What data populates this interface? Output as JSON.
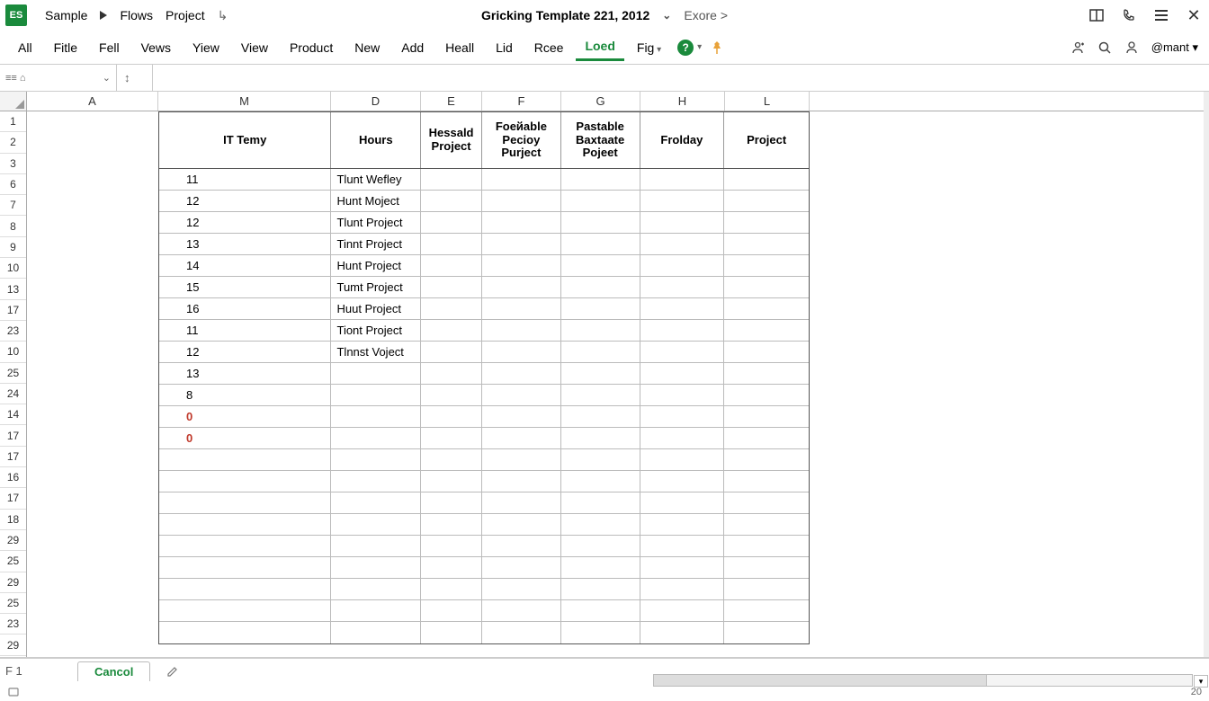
{
  "titlebar": {
    "app_badge": "ES",
    "breadcrumbs": [
      "Sample",
      "Flows",
      "Project"
    ],
    "doc_title": "Gricking Template 221, 2012",
    "more_label": "Exore >",
    "account_label": "@mant"
  },
  "ribbon": {
    "tabs": [
      "All",
      "Fitle",
      "Fell",
      "Vews",
      "Yiew",
      "View",
      "Product",
      "New",
      "Add",
      "Heall",
      "Lid",
      "Rcee",
      "Loed",
      "Fig"
    ],
    "active_index": 12,
    "user_label": "mant"
  },
  "formula": {
    "namebox_icons": "≡≡   ⌂"
  },
  "columns": [
    "A",
    "M",
    "D",
    "E",
    "F",
    "G",
    "H",
    "L"
  ],
  "col_widths": {
    "A": 146,
    "M": 192,
    "D": 100,
    "E": 68,
    "F": 88,
    "G": 88,
    "H": 94,
    "L": 94
  },
  "row_labels": [
    "1",
    "2",
    "3",
    "6",
    "7",
    "8",
    "9",
    "10",
    "13",
    "17",
    "23",
    "10",
    "25",
    "24",
    "14",
    "17",
    "17",
    "16",
    "17",
    "18",
    "29",
    "25",
    "29",
    "25",
    "23",
    "29"
  ],
  "table": {
    "headers": {
      "M": "IT Temy",
      "D": "Hours",
      "E": "Hessald Project",
      "F": "Foeйable Pecioy Purject",
      "G": "Pastable Baxtaate Pojeet",
      "H": "Frolday",
      "L": "Project"
    },
    "rows": [
      {
        "M": "11",
        "D": "Tlunt Wefley"
      },
      {
        "M": "12",
        "D": "Hunt Moject"
      },
      {
        "M": "12",
        "D": "Tlunt Project"
      },
      {
        "M": "13",
        "D": "Tinnt Project"
      },
      {
        "M": "14",
        "D": "Hunt Project"
      },
      {
        "M": "15",
        "D": "Tumt Project"
      },
      {
        "M": "16",
        "D": "Huut Project"
      },
      {
        "M": "11",
        "D": "Tiont Project"
      },
      {
        "M": "12",
        "D": "Tlnnst Voject"
      },
      {
        "M": "13",
        "D": ""
      },
      {
        "M": "8",
        "D": ""
      },
      {
        "M": "0",
        "D": "",
        "red": true
      },
      {
        "M": "0",
        "D": "",
        "red": true
      }
    ],
    "empty_rows_after": 9
  },
  "sheetbar": {
    "cellref": "F 1",
    "active_tab": "Cancol"
  },
  "status": {
    "right": "20"
  }
}
